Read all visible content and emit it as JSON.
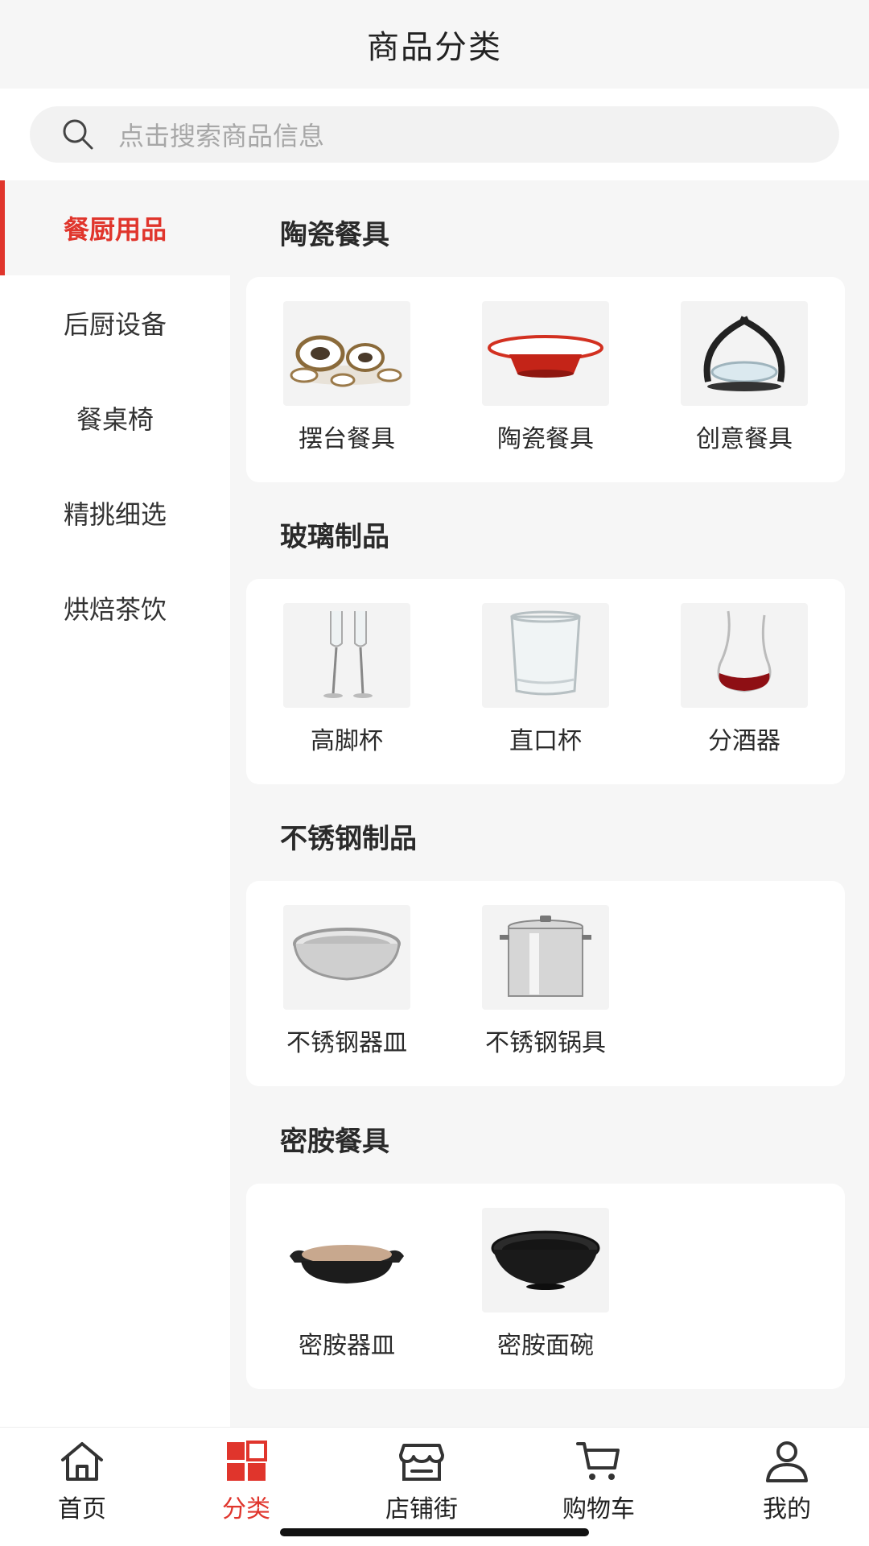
{
  "header": {
    "title": "商品分类"
  },
  "search": {
    "placeholder": "点击搜索商品信息"
  },
  "sidebar": {
    "items": [
      {
        "label": "餐厨用品",
        "active": true
      },
      {
        "label": "后厨设备",
        "active": false
      },
      {
        "label": "餐桌椅",
        "active": false
      },
      {
        "label": "精挑细选",
        "active": false
      },
      {
        "label": "烘焙茶饮",
        "active": false
      }
    ]
  },
  "sections": [
    {
      "title": "陶瓷餐具",
      "items": [
        {
          "label": "摆台餐具"
        },
        {
          "label": "陶瓷餐具"
        },
        {
          "label": "创意餐具"
        }
      ]
    },
    {
      "title": "玻璃制品",
      "items": [
        {
          "label": "高脚杯"
        },
        {
          "label": "直口杯"
        },
        {
          "label": "分酒器"
        }
      ]
    },
    {
      "title": "不锈钢制品",
      "items": [
        {
          "label": "不锈钢器皿"
        },
        {
          "label": "不锈钢锅具"
        }
      ]
    },
    {
      "title": "密胺餐具",
      "items": [
        {
          "label": "密胺器皿"
        },
        {
          "label": "密胺面碗"
        }
      ]
    }
  ],
  "tabbar": {
    "items": [
      {
        "label": "首页",
        "icon": "home-icon"
      },
      {
        "label": "分类",
        "icon": "category-icon",
        "active": true
      },
      {
        "label": "店铺街",
        "icon": "store-icon"
      },
      {
        "label": "购物车",
        "icon": "cart-icon"
      },
      {
        "label": "我的",
        "icon": "user-icon"
      }
    ]
  },
  "colors": {
    "accent": "#e0352c",
    "background": "#f6f6f6",
    "card": "#ffffff"
  }
}
